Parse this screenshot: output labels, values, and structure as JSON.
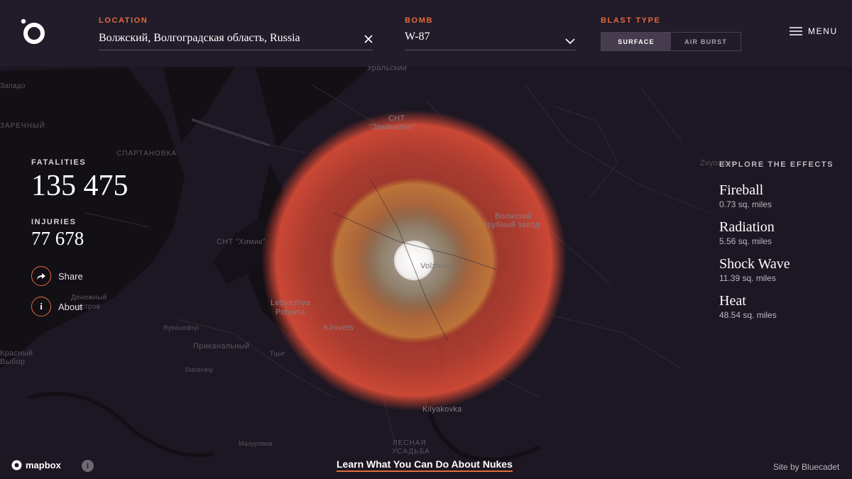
{
  "header": {
    "location_label": "Location",
    "location_value": "Волжский, Волгоградская область, Russia",
    "bomb_label": "Bomb",
    "bomb_value": "W-87",
    "blast_label": "Blast Type",
    "blast_options": [
      "Surface",
      "Air Burst"
    ],
    "blast_selected": "Surface",
    "menu_label": "Menu"
  },
  "stats": {
    "fatalities_label": "Fatalities",
    "fatalities_value": "135 475",
    "injuries_label": "Injuries",
    "injuries_value": "77 678"
  },
  "actions": {
    "share_label": "Share",
    "about_label": "About",
    "about_icon_glyph": "i"
  },
  "effects": {
    "title": "Explore the Effects",
    "items": [
      {
        "name": "Fireball",
        "area": "0.73 sq. miles"
      },
      {
        "name": "Radiation",
        "area": "5.56 sq. miles"
      },
      {
        "name": "Shock Wave",
        "area": "11.39 sq. miles"
      },
      {
        "name": "Heat",
        "area": "48.54 sq. miles"
      }
    ]
  },
  "map_labels": {
    "uralskiy": "Уральский",
    "snt_zakanalye_1": "СНТ",
    "snt_zakanalye_2": "\"Заканалье\"",
    "spartanovka": "Спартановка",
    "zvyozdny": "Zvyozdny",
    "volzhsky_zavod_1": "Волжский",
    "volzhsky_zavod_2": "трубный завод",
    "snt_khimik": "СНТ \"Химик\"",
    "volzhskiy": "Volzhskiy",
    "lebyazhya_1": "Lebyazhya",
    "lebyazhya_2": "Polyana",
    "kirovets": "Kirovets",
    "rybovodny": "Rybovodnyi",
    "prikanalny": "Приканальный",
    "kilyakovka": "Kilyakovka",
    "lesnaya_1": "Лесная",
    "lesnaya_2": "усадьба",
    "denezhny_1": "Денежный",
    "denezhny_2": "остров",
    "zarechny": "Заречный",
    "krasny_1": "Красный",
    "krasny_2": "Выбор",
    "mazurovka": "Мазуровка",
    "zapadny": "Западо",
    "starenkiy": "Starenkiy",
    "tsyk": "Тцыг"
  },
  "footer": {
    "mapbox_label": "mapbox",
    "info_glyph": "i",
    "learn_link": "Learn What You Can Do About Nukes",
    "credit": "Site by Bluecadet"
  },
  "colors": {
    "accent": "#e26b3a",
    "heat_ring": "#c8402f",
    "shock_ring": "#b86a2e",
    "radiation_ring": "#8a8a6a",
    "fireball": "#f4f2f0",
    "header_bg": "#221b29",
    "map_bg": "#1c1722"
  },
  "icons": {
    "logo": "bluecadet-outrider-logo",
    "clear": "close-icon",
    "dropdown": "chevron-down-icon",
    "menu": "hamburger-icon",
    "share": "share-arrow-icon",
    "about": "info-icon",
    "mapbox": "mapbox-logo-icon"
  }
}
